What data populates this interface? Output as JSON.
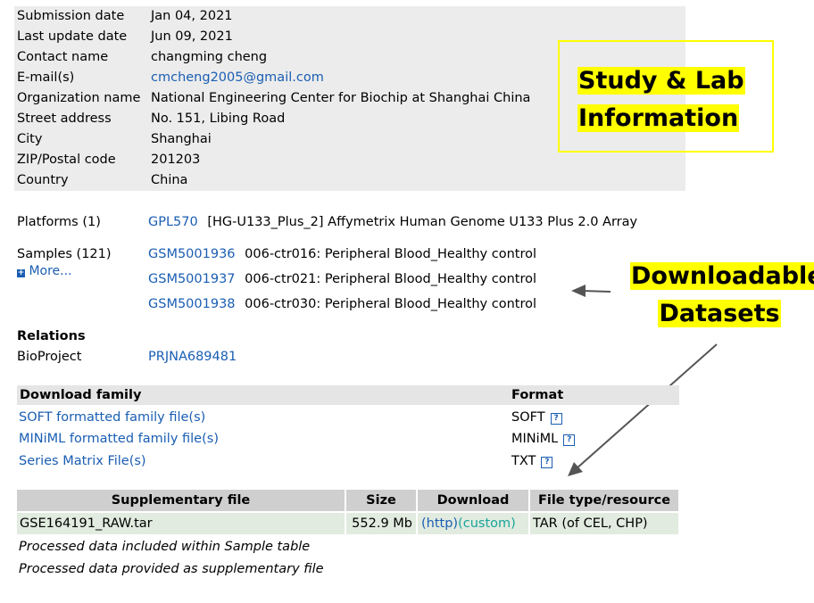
{
  "contact": [
    {
      "label": "Submission date",
      "value": "Jan 04, 2021"
    },
    {
      "label": "Last update date",
      "value": "Jun 09, 2021"
    },
    {
      "label": "Contact name",
      "value": "changming cheng"
    },
    {
      "label": "E-mail(s)",
      "value": "cmcheng2005@gmail.com"
    },
    {
      "label": "Organization name",
      "value": "National Engineering Center for Biochip at Shanghai China"
    },
    {
      "label": "Street address",
      "value": "No. 151, Libing Road"
    },
    {
      "label": "City",
      "value": "Shanghai"
    },
    {
      "label": "ZIP/Postal code",
      "value": "201203"
    },
    {
      "label": "Country",
      "value": "China"
    }
  ],
  "annotations": {
    "study_line1": "Study & Lab",
    "study_line2": "Information",
    "datasets_line1": "Downloadable",
    "datasets_line2": "Datasets",
    "highlight_color": "#ffff00"
  },
  "platforms": {
    "label": "Platforms (1)",
    "id": "GPL570",
    "desc": "[HG-U133_Plus_2] Affymetrix Human Genome U133 Plus 2.0 Array"
  },
  "samples": {
    "label": "Samples (121)",
    "more": "More...",
    "items": [
      {
        "id": "GSM5001936",
        "desc": "006-ctr016: Peripheral Blood_Healthy control"
      },
      {
        "id": "GSM5001937",
        "desc": "006-ctr021: Peripheral Blood_Healthy control"
      },
      {
        "id": "GSM5001938",
        "desc": "006-ctr030: Peripheral Blood_Healthy control"
      }
    ]
  },
  "relations": {
    "heading": "Relations",
    "bioproject_label": "BioProject",
    "bioproject_id": "PRJNA689481"
  },
  "download_family": {
    "header_family": "Download family",
    "header_format": "Format",
    "rows": [
      {
        "name": "SOFT formatted family file(s)",
        "format": "SOFT"
      },
      {
        "name": "MINiML formatted family file(s)",
        "format": "MINiML"
      },
      {
        "name": "Series Matrix File(s)",
        "format": "TXT"
      }
    ],
    "help_glyph": "?"
  },
  "supplementary": {
    "headers": [
      "Supplementary file",
      "Size",
      "Download",
      "File type/resource"
    ],
    "row": {
      "file": "GSE164191_RAW.tar",
      "size": "552.9 Mb",
      "http": "(http)",
      "custom": "(custom)",
      "type": "TAR (of CEL, CHP)"
    },
    "note1": "Processed data included within Sample table",
    "note2": "Processed data provided as supplementary file"
  }
}
